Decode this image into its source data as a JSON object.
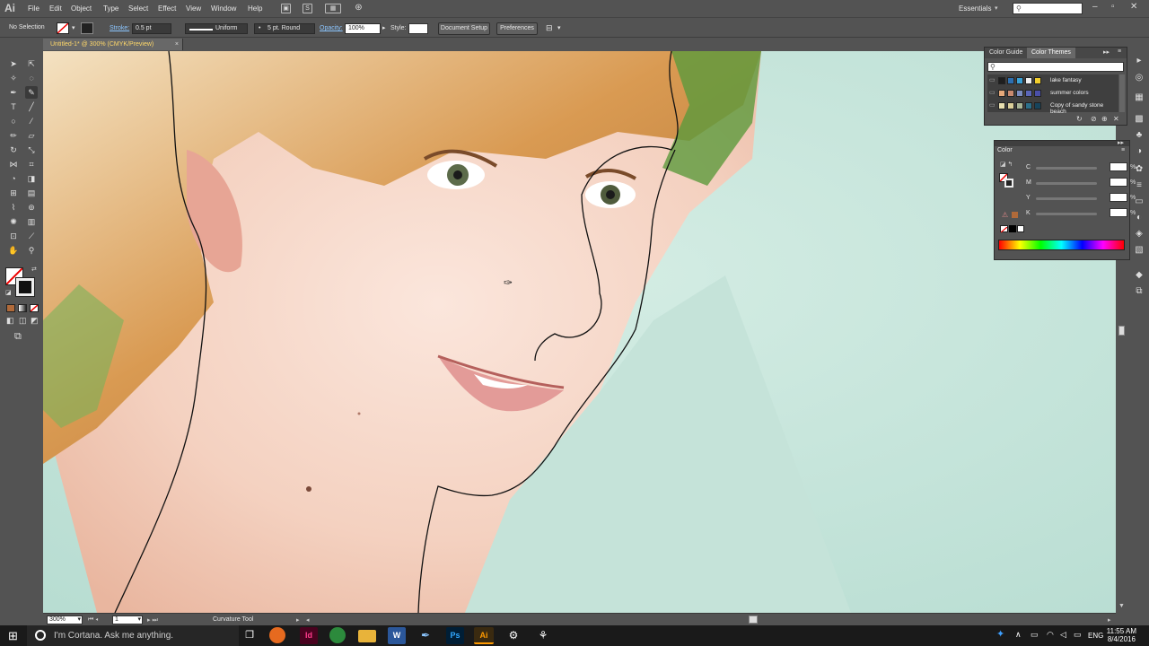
{
  "app": {
    "logo": "Ai"
  },
  "menu": [
    "File",
    "Edit",
    "Object",
    "Type",
    "Select",
    "Effect",
    "View",
    "Window",
    "Help"
  ],
  "workspace": "Essentials",
  "control": {
    "selection": "No Selection",
    "stroke_label": "Stroke:",
    "stroke_value": "0.5 pt",
    "profile": "Uniform",
    "brush": "5 pt. Round",
    "opacity_label": "Opacity:",
    "opacity_value": "100%",
    "style_label": "Style:",
    "doc_setup": "Document Setup",
    "preferences": "Preferences"
  },
  "document_tab": {
    "title": "Untitled-1* @ 300% (CMYK/Preview)",
    "close": "×"
  },
  "status": {
    "zoom": "300%",
    "artboard": "1",
    "tool": "Curvature Tool"
  },
  "color_guide_panel": {
    "tabs": [
      "Color Guide",
      "Color Themes"
    ],
    "themes": [
      {
        "name": "lake fantasy",
        "colors": [
          "#1e1e1e",
          "#2d6fb0",
          "#3aa0d6",
          "#f0f0f0",
          "#f3cf2e"
        ]
      },
      {
        "name": "summer colors",
        "colors": [
          "#e6a97a",
          "#c98a6f",
          "#7b8cc0",
          "#5b66b8",
          "#4a4fa8"
        ]
      },
      {
        "name": "Copy of sandy stone beach",
        "colors": [
          "#e8dfb0",
          "#dbcf9a",
          "#a8b496",
          "#2c6f8a",
          "#17445c"
        ]
      }
    ]
  },
  "color_panel": {
    "title": "Color",
    "channels": [
      "C",
      "M",
      "Y",
      "K"
    ],
    "pct": "%",
    "spectrum": [
      "#ff0000",
      "#ffff00",
      "#00ff00",
      "#00ffff",
      "#0000ff",
      "#ff00ff",
      "#ff0000"
    ]
  },
  "taskbar": {
    "cortana": "I'm Cortana. Ask me anything.",
    "time": "11:55 AM",
    "date": "8/4/2016",
    "lang": "ENG"
  }
}
